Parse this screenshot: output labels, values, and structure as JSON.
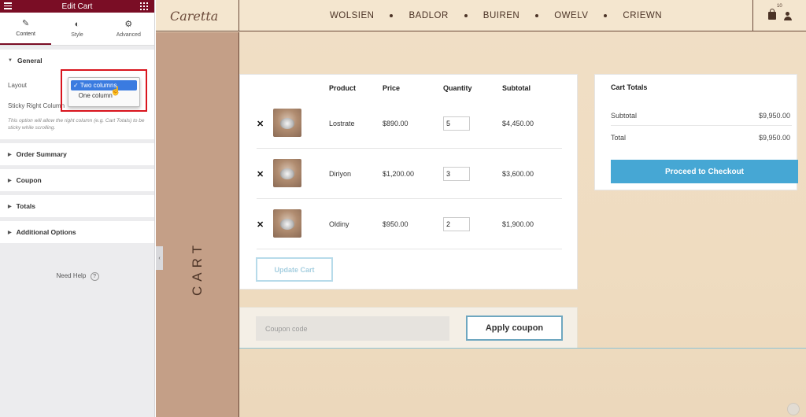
{
  "panel": {
    "title": "Edit Cart",
    "tabs": [
      {
        "label": "Content",
        "icon": "pencil-icon"
      },
      {
        "label": "Style",
        "icon": "half-circle-icon"
      },
      {
        "label": "Advanced",
        "icon": "gear-icon"
      }
    ],
    "general": {
      "title": "General",
      "layout_label": "Layout",
      "sticky_label": "Sticky Right Column",
      "help_text": "This option will allow the right column (e.g. Cart Totals) to be sticky while scrolling.",
      "layout_options": [
        "Two columns",
        "One column"
      ],
      "layout_selected": "Two columns"
    },
    "sections": [
      "Order Summary",
      "Coupon",
      "Totals",
      "Additional Options"
    ],
    "need_help": "Need Help"
  },
  "site": {
    "logo": "Caretta",
    "nav": [
      "WOLSIEN",
      "BADLOR",
      "BUIREN",
      "OWELV",
      "CRIEWN"
    ],
    "cart_count": "10",
    "page_label": "CART"
  },
  "cart": {
    "headers": {
      "product": "Product",
      "price": "Price",
      "quantity": "Quantity",
      "subtotal": "Subtotal"
    },
    "items": [
      {
        "name": "Lostrate",
        "price": "$890.00",
        "qty": "5",
        "subtotal": "$4,450.00"
      },
      {
        "name": "Diriyon",
        "price": "$1,200.00",
        "qty": "3",
        "subtotal": "$3,600.00"
      },
      {
        "name": "Oldiny",
        "price": "$950.00",
        "qty": "2",
        "subtotal": "$1,900.00"
      }
    ],
    "update_label": "Update Cart",
    "coupon_placeholder": "Coupon code",
    "apply_label": "Apply coupon"
  },
  "totals": {
    "title": "Cart Totals",
    "subtotal_label": "Subtotal",
    "subtotal_value": "$9,950.00",
    "total_label": "Total",
    "total_value": "$9,950.00",
    "checkout_label": "Proceed to Checkout"
  }
}
